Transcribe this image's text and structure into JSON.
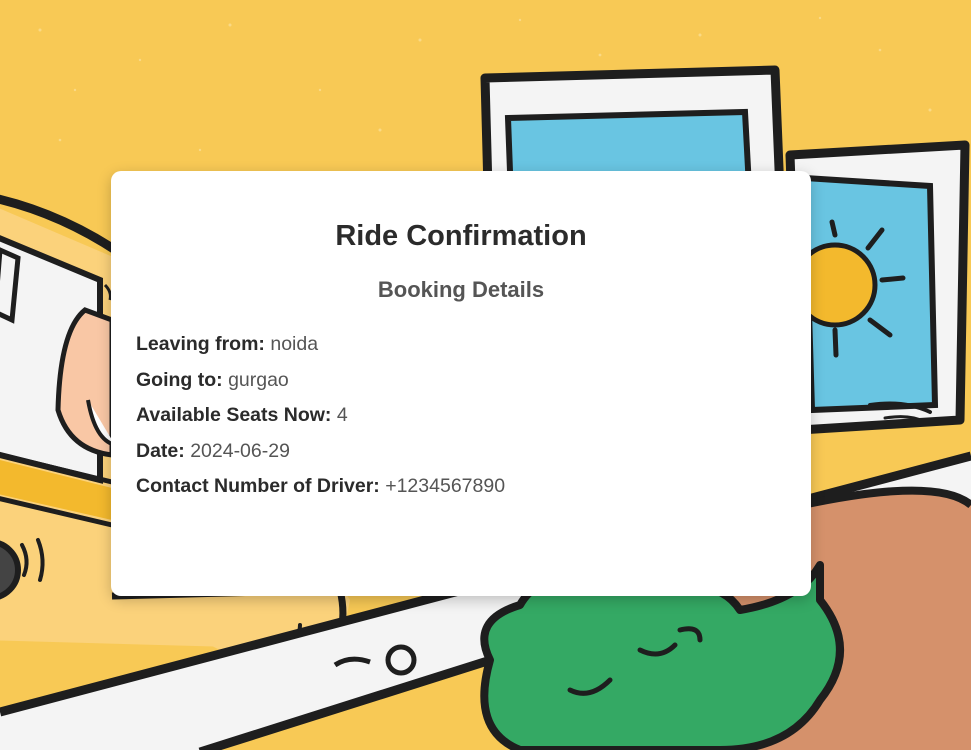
{
  "page": {
    "title": "Ride Confirmation",
    "subtitle": "Booking Details"
  },
  "details": [
    {
      "label": "Leaving from:",
      "value": "noida"
    },
    {
      "label": "Going to:",
      "value": "gurgao"
    },
    {
      "label": "Available Seats Now:",
      "value": "4"
    },
    {
      "label": "Date:",
      "value": "2024-06-29"
    },
    {
      "label": "Contact Number of Driver:",
      "value": "+1234567890"
    }
  ],
  "colors": {
    "background": "#f8c955",
    "card": "#ffffff",
    "heading": "#2b2b2b",
    "text": "#555555",
    "illustration_sky": "#69c5e2",
    "illustration_sun": "#f3b92d",
    "illustration_bush": "#34a964",
    "illustration_ground": "#d5916b"
  },
  "icons": [
    "sun-icon"
  ]
}
